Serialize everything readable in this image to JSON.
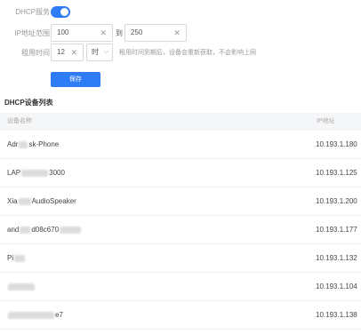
{
  "dhcp": {
    "enable_label": "DHCP服务",
    "enabled": true,
    "range_label": "IP地址范围",
    "range_start": "100",
    "range_sep": "到",
    "range_end": "250",
    "lease_label": "租用时间",
    "lease_value": "12",
    "lease_unit": "时",
    "lease_hint": "租用时间到期后，设备会重新获取，不会影响上网",
    "save_label": "保存"
  },
  "device_list": {
    "title": "DHCP设备列表",
    "columns": [
      "设备名称",
      "IP地址"
    ],
    "rows": [
      {
        "name": "Adr",
        "name_tail": "sk-Phone",
        "ip": "10.193.1.180"
      },
      {
        "name": "LAP",
        "name_tail": "3000",
        "ip": "10.193.1.125"
      },
      {
        "name": "Xia",
        "name_tail": "AudioSpeaker",
        "ip": "10.193.1.200"
      },
      {
        "name": "and",
        "name_tail": "d08c670",
        "ip": "10.193.1.177"
      },
      {
        "name": "Pi",
        "name_tail": "",
        "ip": "10.193.1.132"
      },
      {
        "name": "",
        "name_tail": "",
        "ip": "10.193.1.104"
      },
      {
        "name": "",
        "name_tail": "e7",
        "ip": "10.193.1.138"
      }
    ]
  },
  "colors": {
    "accent": "#2f7df6"
  }
}
